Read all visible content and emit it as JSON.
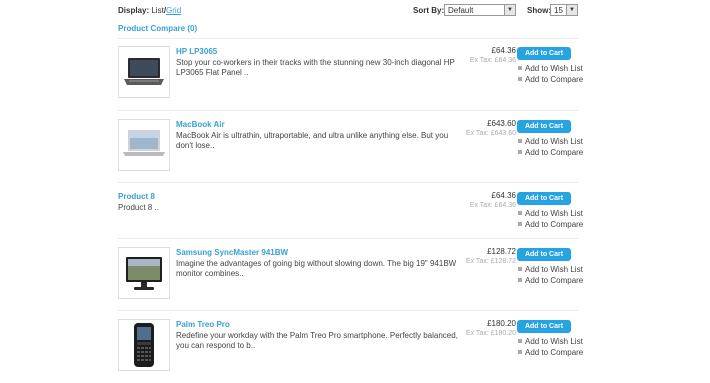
{
  "toolbar": {
    "display_label": "Display:",
    "display_list": "List",
    "display_sep": "/",
    "display_grid": "Grid",
    "sort_label": "Sort By:",
    "sort_value": "Default",
    "show_label": "Show:",
    "show_value": "15"
  },
  "compare_link": "Product Compare (0)",
  "actions": {
    "cart": "Add to Cart",
    "wishlist": "Add to Wish List",
    "compare": "Add to Compare"
  },
  "products": [
    {
      "name": "HP LP3065",
      "desc": "Stop your co-workers in their tracks with the stunning new 30-inch diagonal HP LP3065 Flat Panel ..",
      "price": "£64.36",
      "tax": "Ex Tax: £64.36",
      "image": "laptop-image"
    },
    {
      "name": "MacBook Air",
      "desc": "MacBook Air is ultrathin, ultraportable, and ultra unlike anything else. But you don't lose..",
      "price": "£643.60",
      "tax": "Ex Tax: £643.60",
      "image": "macbook-image"
    },
    {
      "name": "Product 8",
      "desc": "Product 8 ..",
      "price": "£64.36",
      "tax": "Ex Tax: £64.36",
      "image": ""
    },
    {
      "name": "Samsung SyncMaster 941BW",
      "desc": "Imagine the advantages of going big without slowing down. The big 19\" 941BW monitor combines..",
      "price": "£128.72",
      "tax": "Ex Tax: £128.72",
      "image": "monitor-image"
    },
    {
      "name": "Palm Treo Pro",
      "desc": "Redefine your workday with the Palm Treo Pro smartphone. Perfectly balanced, you can respond to b..",
      "price": "£180.20",
      "tax": "Ex Tax: £180.20",
      "image": "phone-image"
    }
  ]
}
